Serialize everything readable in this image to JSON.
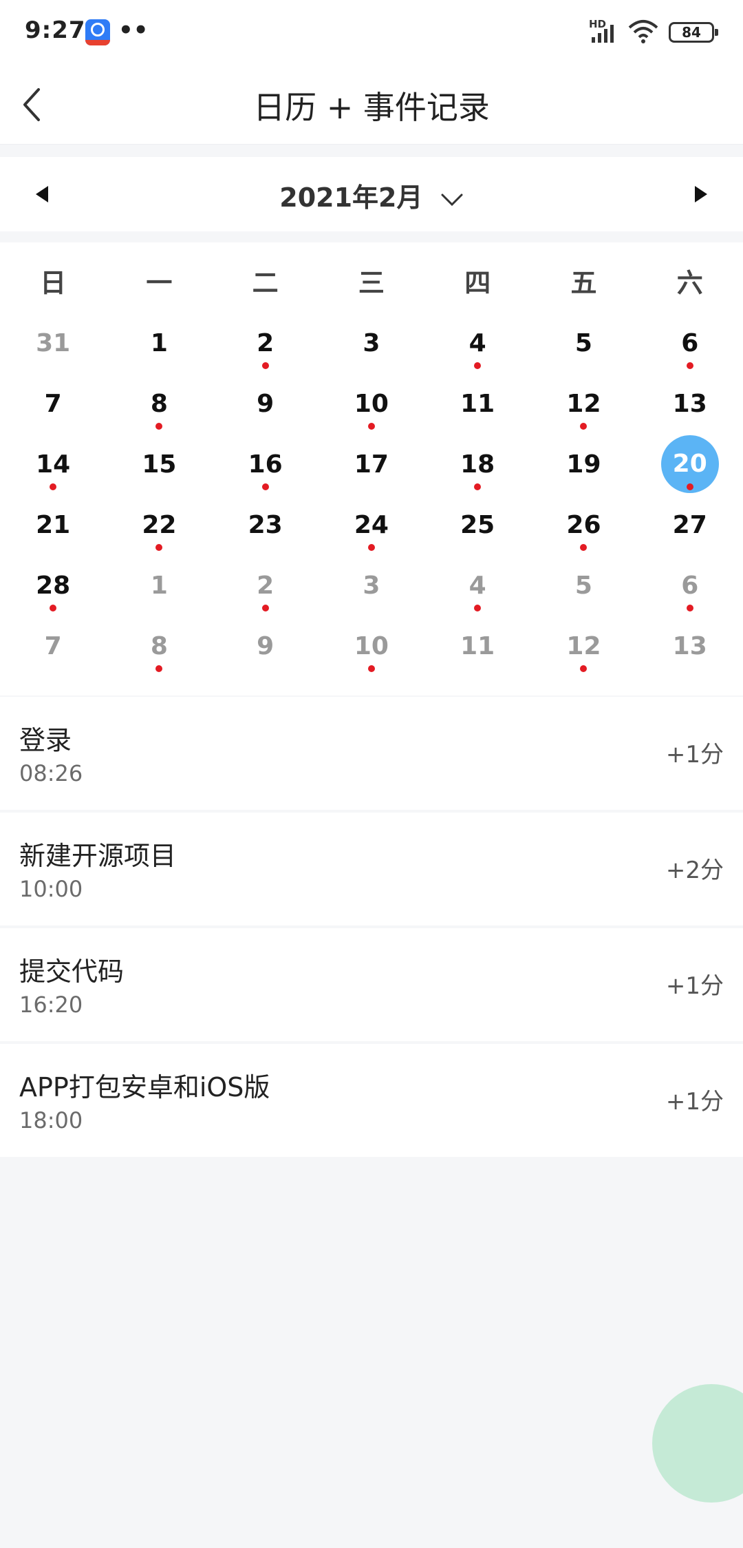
{
  "status_bar": {
    "time": "9:27",
    "dots": "••",
    "network": "HD",
    "battery": "84"
  },
  "header": {
    "title": "日历 + 事件记录"
  },
  "calendar": {
    "month_label": "2021年2月",
    "weekdays": [
      "日",
      "一",
      "二",
      "三",
      "四",
      "五",
      "六"
    ],
    "weeks": [
      [
        {
          "day": "31",
          "other": true,
          "dot": false
        },
        {
          "day": "1",
          "other": false,
          "dot": false
        },
        {
          "day": "2",
          "other": false,
          "dot": true
        },
        {
          "day": "3",
          "other": false,
          "dot": false
        },
        {
          "day": "4",
          "other": false,
          "dot": true
        },
        {
          "day": "5",
          "other": false,
          "dot": false
        },
        {
          "day": "6",
          "other": false,
          "dot": true
        }
      ],
      [
        {
          "day": "7",
          "other": false,
          "dot": false
        },
        {
          "day": "8",
          "other": false,
          "dot": true
        },
        {
          "day": "9",
          "other": false,
          "dot": false
        },
        {
          "day": "10",
          "other": false,
          "dot": true
        },
        {
          "day": "11",
          "other": false,
          "dot": false
        },
        {
          "day": "12",
          "other": false,
          "dot": true
        },
        {
          "day": "13",
          "other": false,
          "dot": false
        }
      ],
      [
        {
          "day": "14",
          "other": false,
          "dot": true
        },
        {
          "day": "15",
          "other": false,
          "dot": false
        },
        {
          "day": "16",
          "other": false,
          "dot": true
        },
        {
          "day": "17",
          "other": false,
          "dot": false
        },
        {
          "day": "18",
          "other": false,
          "dot": true
        },
        {
          "day": "19",
          "other": false,
          "dot": false
        },
        {
          "day": "20",
          "other": false,
          "dot": true,
          "selected": true
        }
      ],
      [
        {
          "day": "21",
          "other": false,
          "dot": false
        },
        {
          "day": "22",
          "other": false,
          "dot": true
        },
        {
          "day": "23",
          "other": false,
          "dot": false
        },
        {
          "day": "24",
          "other": false,
          "dot": true
        },
        {
          "day": "25",
          "other": false,
          "dot": false
        },
        {
          "day": "26",
          "other": false,
          "dot": true
        },
        {
          "day": "27",
          "other": false,
          "dot": false
        }
      ],
      [
        {
          "day": "28",
          "other": false,
          "dot": true
        },
        {
          "day": "1",
          "other": true,
          "dot": false
        },
        {
          "day": "2",
          "other": true,
          "dot": true
        },
        {
          "day": "3",
          "other": true,
          "dot": false
        },
        {
          "day": "4",
          "other": true,
          "dot": true
        },
        {
          "day": "5",
          "other": true,
          "dot": false
        },
        {
          "day": "6",
          "other": true,
          "dot": true
        }
      ],
      [
        {
          "day": "7",
          "other": true,
          "dot": false
        },
        {
          "day": "8",
          "other": true,
          "dot": true
        },
        {
          "day": "9",
          "other": true,
          "dot": false
        },
        {
          "day": "10",
          "other": true,
          "dot": true
        },
        {
          "day": "11",
          "other": true,
          "dot": false
        },
        {
          "day": "12",
          "other": true,
          "dot": true
        },
        {
          "day": "13",
          "other": true,
          "dot": false
        }
      ]
    ]
  },
  "events": [
    {
      "name": "登录",
      "time": "08:26",
      "score": "+1分"
    },
    {
      "name": "新建开源项目",
      "time": "10:00",
      "score": "+2分"
    },
    {
      "name": "提交代码",
      "time": "16:20",
      "score": "+1分"
    },
    {
      "name": "APP打包安卓和iOS版",
      "time": "18:00",
      "score": "+1分"
    }
  ],
  "colors": {
    "selected_day": "#5bb4f5",
    "event_dot": "#e31b23",
    "fab": "#c5ead6"
  }
}
